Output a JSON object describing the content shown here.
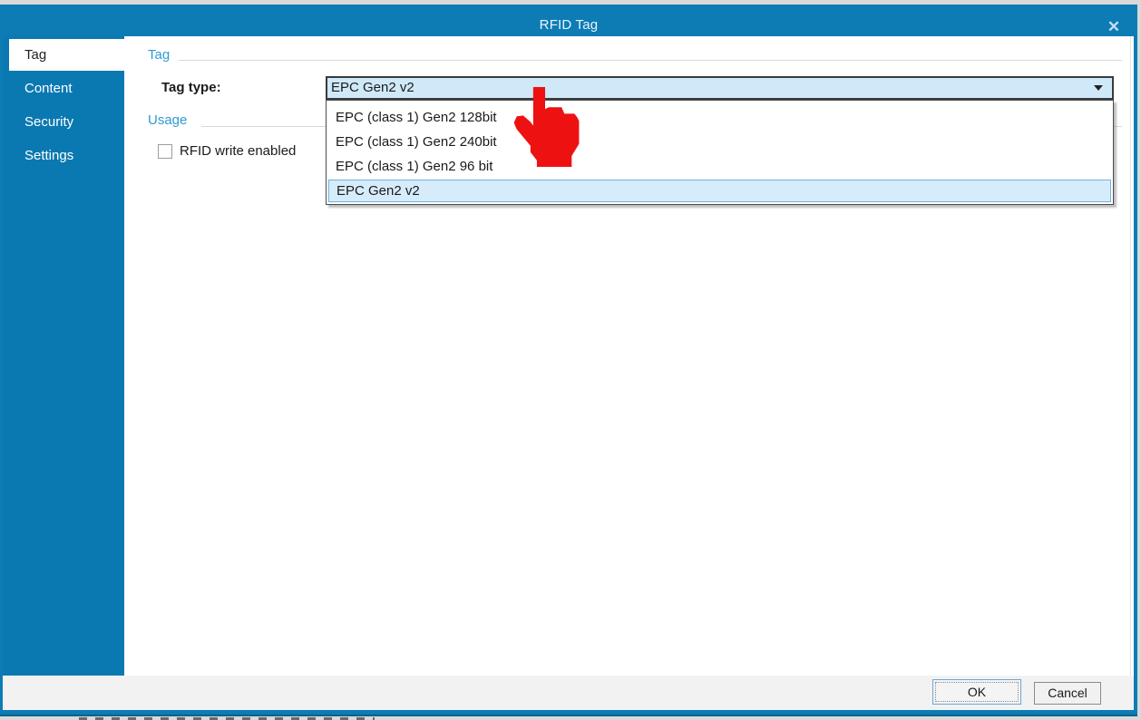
{
  "window": {
    "title": "RFID Tag"
  },
  "icons": {
    "close": "✕",
    "dropdown_arrow": "▾"
  },
  "sidebar": {
    "items": [
      {
        "label": "Tag",
        "selected": true
      },
      {
        "label": "Content",
        "selected": false
      },
      {
        "label": "Security",
        "selected": false
      },
      {
        "label": "Settings",
        "selected": false
      }
    ]
  },
  "main": {
    "tag_group": {
      "title": "Tag",
      "tag_type_label": "Tag type:",
      "tag_type_value": "EPC Gen2 v2"
    },
    "usage_group": {
      "title": "Usage",
      "rfid_write_checkbox_label": "RFID write enabled",
      "rfid_write_checked": false
    }
  },
  "dropdown": {
    "options": [
      "EPC (class 1) Gen2 128bit",
      "EPC (class 1) Gen2 240bit",
      "EPC (class 1) Gen2 96 bit",
      "EPC Gen2 v2"
    ],
    "highlighted": "EPC Gen2 v2",
    "highlighted_index": 3
  },
  "footer": {
    "ok_label": "OK",
    "cancel_label": "Cancel"
  },
  "annotations": {
    "cursor": "red-hand-pointer-overlay"
  },
  "colors": {
    "titlebar": "#0d7cb5",
    "sidebar": "#0b79b1",
    "group_header": "#2f9ad4",
    "combo_bg": "#cfe9f9",
    "highlight_bg": "#d7ecfa",
    "highlight_border": "#70b2dd",
    "footer_bg": "#f2f2f2",
    "cursor_red": "#ee1111"
  }
}
